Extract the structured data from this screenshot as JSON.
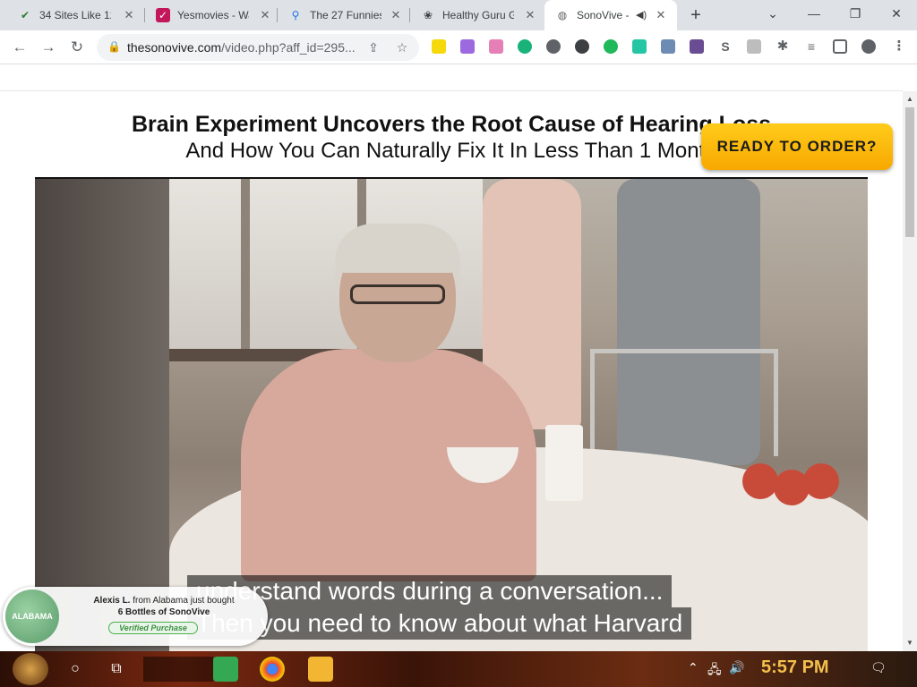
{
  "browser": {
    "tabs": [
      {
        "title": "34 Sites Like 123",
        "favicon": "checkmark-icon",
        "active": false
      },
      {
        "title": "Yesmovies - Wa",
        "favicon": "yesmovies-icon",
        "active": false
      },
      {
        "title": "The 27 Funniest",
        "favicon": "map-pin-icon",
        "active": false
      },
      {
        "title": "Healthy Guru Gi",
        "favicon": "lotus-icon",
        "active": false
      },
      {
        "title": "SonoVive -",
        "favicon": "globe-icon",
        "active": true
      }
    ],
    "url_host": "thesonovive.com",
    "url_path": "/video.php?aff_id=295..."
  },
  "page": {
    "headline": "Brain Experiment Uncovers the Root Cause of Hearing Loss",
    "subheadline": "And How You Can Naturally Fix It In Less Than 1 Month",
    "cta_label": "READY TO ORDER?",
    "subtitle_line1": "understand words during a conversation...",
    "subtitle_line2": "Then you need to know about what Harvard"
  },
  "notification": {
    "map_label": "ALABAMA",
    "buyer": "Alexis L.",
    "location_text": "from Alabama just bought",
    "product_text": "6 Bottles of SonoVive",
    "badge": "Verified Purchase"
  },
  "taskbar": {
    "time": "5:57 PM"
  }
}
